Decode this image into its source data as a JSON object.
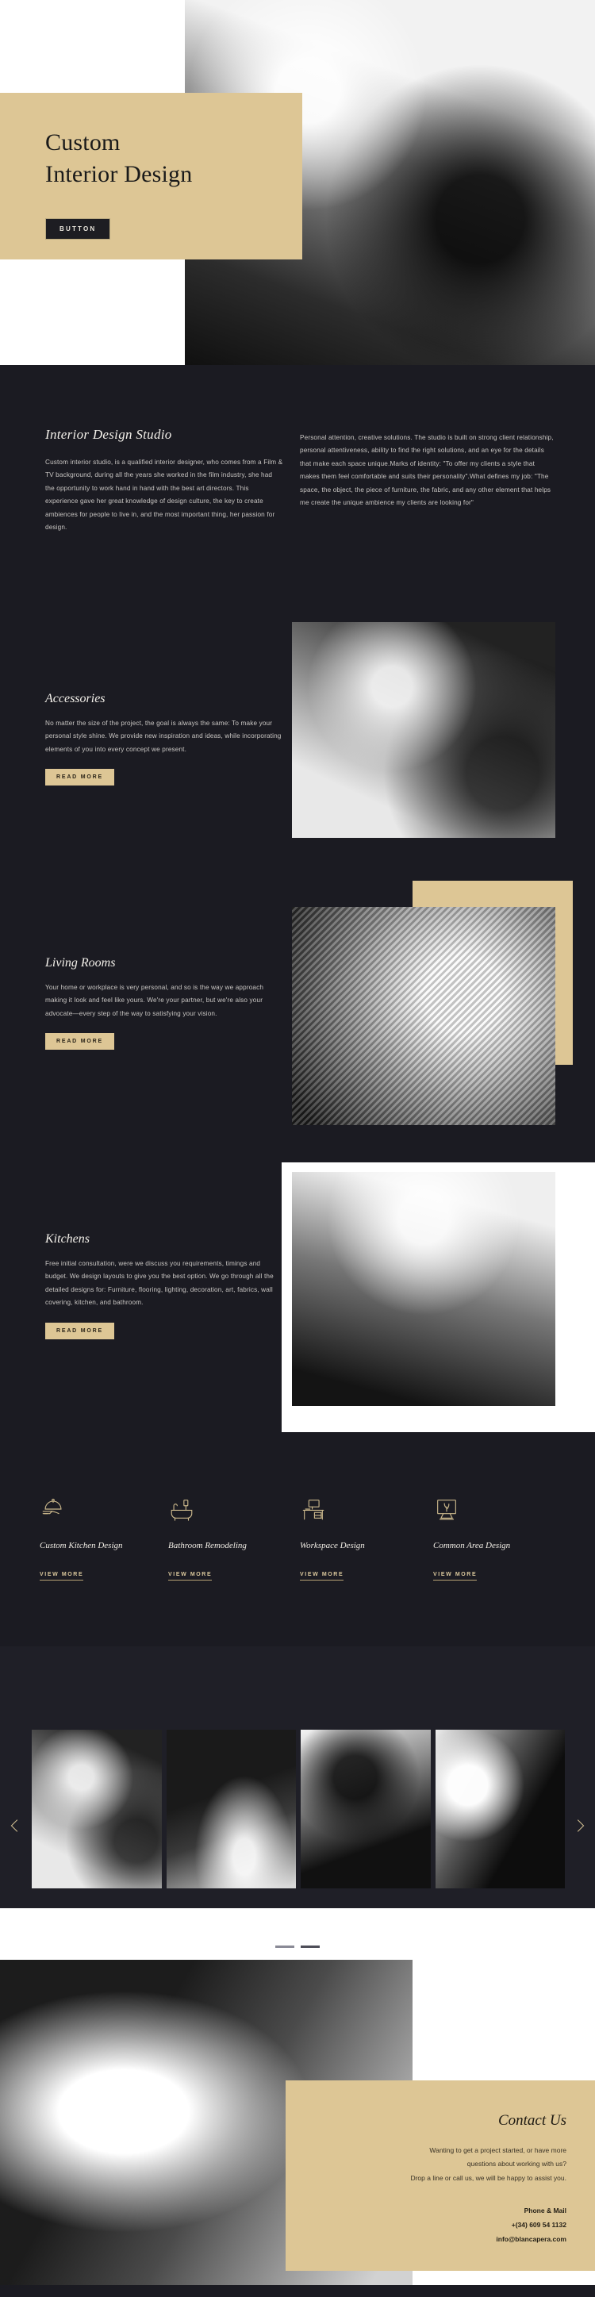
{
  "colors": {
    "tan": "#ddc695",
    "dark": "#1b1b22",
    "darkAlt": "#1f1f27",
    "text": "#c9c6c3",
    "accent": "#d9c79c"
  },
  "hero": {
    "title_line1": "Custom",
    "title_line2": "Interior Design",
    "button_label": "BUTTON"
  },
  "intro": {
    "heading": "Interior Design Studio",
    "left_text": "Custom interior studio, is a qualified interior designer, who comes from a Film & TV background, during all the years she worked in the film industry, she had the opportunity to work hand in hand with the best art directors. This experience gave her great knowledge of design culture, the key to create ambiences for people to live in, and the most important thing, her passion for design.",
    "right_text": "Personal attention, creative solutions. The studio is built on strong client relationship, personal attentiveness, ability to find the right solutions, and an eye for the details that make each space unique.Marks of identity: \"To offer my clients a style that makes them feel comfortable and suits their personality\".What defines my job: \"The space, the object, the piece of furniture, the fabric, and any other element that helps me create the unique ambience my clients are looking for\""
  },
  "features": [
    {
      "heading": "Accessories",
      "text": "No matter the size of the project, the goal is always the same: To make your personal style shine. We provide new inspiration and ideas, while incorporating elements of you into every concept we present.",
      "button_label": "READ MORE"
    },
    {
      "heading": "Living Rooms",
      "text": "Your home or workplace is very personal, and so is the way we approach making it look and feel like yours. We're your partner, but we're also your advocate—every step of the way to satisfying your vision.",
      "button_label": "READ MORE"
    },
    {
      "heading": "Kitchens",
      "text": "Free initial consultation, were we discuss you requirements, timings and budget. We design layouts to give you the best option. We go through all the detailed designs for: Furniture, flooring, lighting, decoration, art, fabrics, wall covering, kitchen, and bathroom.",
      "button_label": "READ MORE"
    }
  ],
  "services": [
    {
      "icon": "serving-tray-icon",
      "label": "Custom Kitchen Design",
      "link_label": "VIEW MORE"
    },
    {
      "icon": "bathtub-shower-icon",
      "label": "Bathroom Remodeling",
      "link_label": "VIEW MORE"
    },
    {
      "icon": "desk-computer-icon",
      "label": "Workspace Design",
      "link_label": "VIEW MORE"
    },
    {
      "icon": "monitor-plant-icon",
      "label": "Common Area Design",
      "link_label": "VIEW MORE"
    }
  ],
  "carousel": {
    "prev_label": "previous-slide",
    "next_label": "next-slide",
    "slide_count": 4,
    "dots": 2,
    "active_dot": 0
  },
  "contact": {
    "heading": "Contact Us",
    "line1": "Wanting to get a project started, or have more",
    "line2": "questions about working with us?",
    "line3": "Drop a line or call us, we will be happy to assist you.",
    "details_title": "Phone & Mail",
    "phone": "+(34) 609 54 1132",
    "email": "info@blancapera.com"
  }
}
